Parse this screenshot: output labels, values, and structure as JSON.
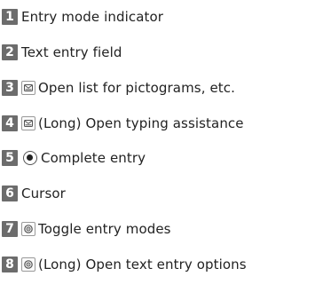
{
  "items": [
    {
      "number": "1",
      "label": "Entry mode indicator",
      "key_icon": "none"
    },
    {
      "number": "2",
      "label": "Text entry field",
      "key_icon": "none"
    },
    {
      "number": "3",
      "label": "Open list for pictograms, etc.",
      "key_icon": "envelope-key-icon"
    },
    {
      "number": "4",
      "label": "(Long) Open typing assistance",
      "key_icon": "envelope-key-icon"
    },
    {
      "number": "5",
      "label": "Complete entry",
      "key_icon": "center-button-icon"
    },
    {
      "number": "6",
      "label": "Cursor",
      "key_icon": "none"
    },
    {
      "number": "7",
      "label": "Toggle entry modes",
      "key_icon": "settings-key-icon"
    },
    {
      "number": "8",
      "label": "(Long) Open text entry options",
      "key_icon": "settings-key-icon"
    }
  ],
  "colors": {
    "number_badge_bg": "#6c6c6c",
    "number_badge_text": "#ffffff",
    "text": "#222222",
    "background": "#ffffff"
  }
}
